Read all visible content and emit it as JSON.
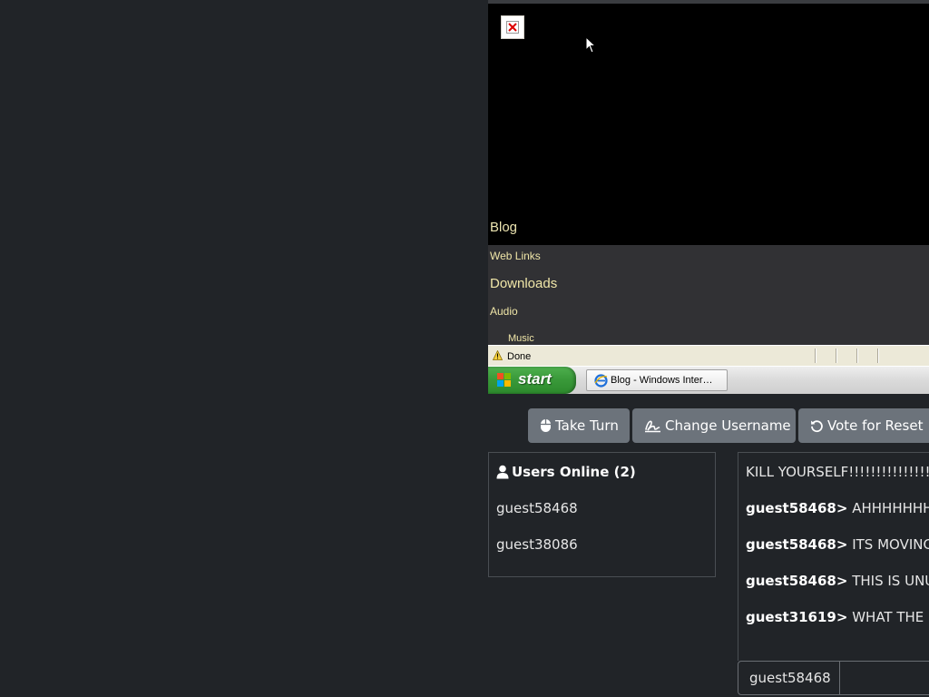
{
  "vm": {
    "links": {
      "blog": "Blog",
      "web_links": "Web Links",
      "downloads": "Downloads",
      "audio": "Audio",
      "music": "Music"
    },
    "status_text": "Done",
    "start_label": "start",
    "taskbar_item": "Blog - Windows Inter…"
  },
  "actions": {
    "take_turn": "Take Turn",
    "change_username": "Change Username",
    "vote_reset": "Vote for Reset"
  },
  "users": {
    "header": "Users Online (2)",
    "list": [
      "guest58468",
      "guest38086"
    ]
  },
  "chat": {
    "messages": [
      {
        "user": "",
        "text": "KILL YOURSELF!!!!!!!!!!!!!!!!!!!!!!!!!"
      },
      {
        "user": "guest58468>",
        "text": " AHHHHHHHHH"
      },
      {
        "user": "guest58468>",
        "text": " ITS MOVING A"
      },
      {
        "user": "guest58468>",
        "text": " THIS IS UNUSA"
      },
      {
        "user": "guest31619>",
        "text": " WHAT THE FUC"
      }
    ],
    "username": "guest58468",
    "input_value": ""
  },
  "colors": {
    "page_bg": "#212428",
    "button_bg": "#6c737b",
    "link_color": "#f0e6a8"
  }
}
